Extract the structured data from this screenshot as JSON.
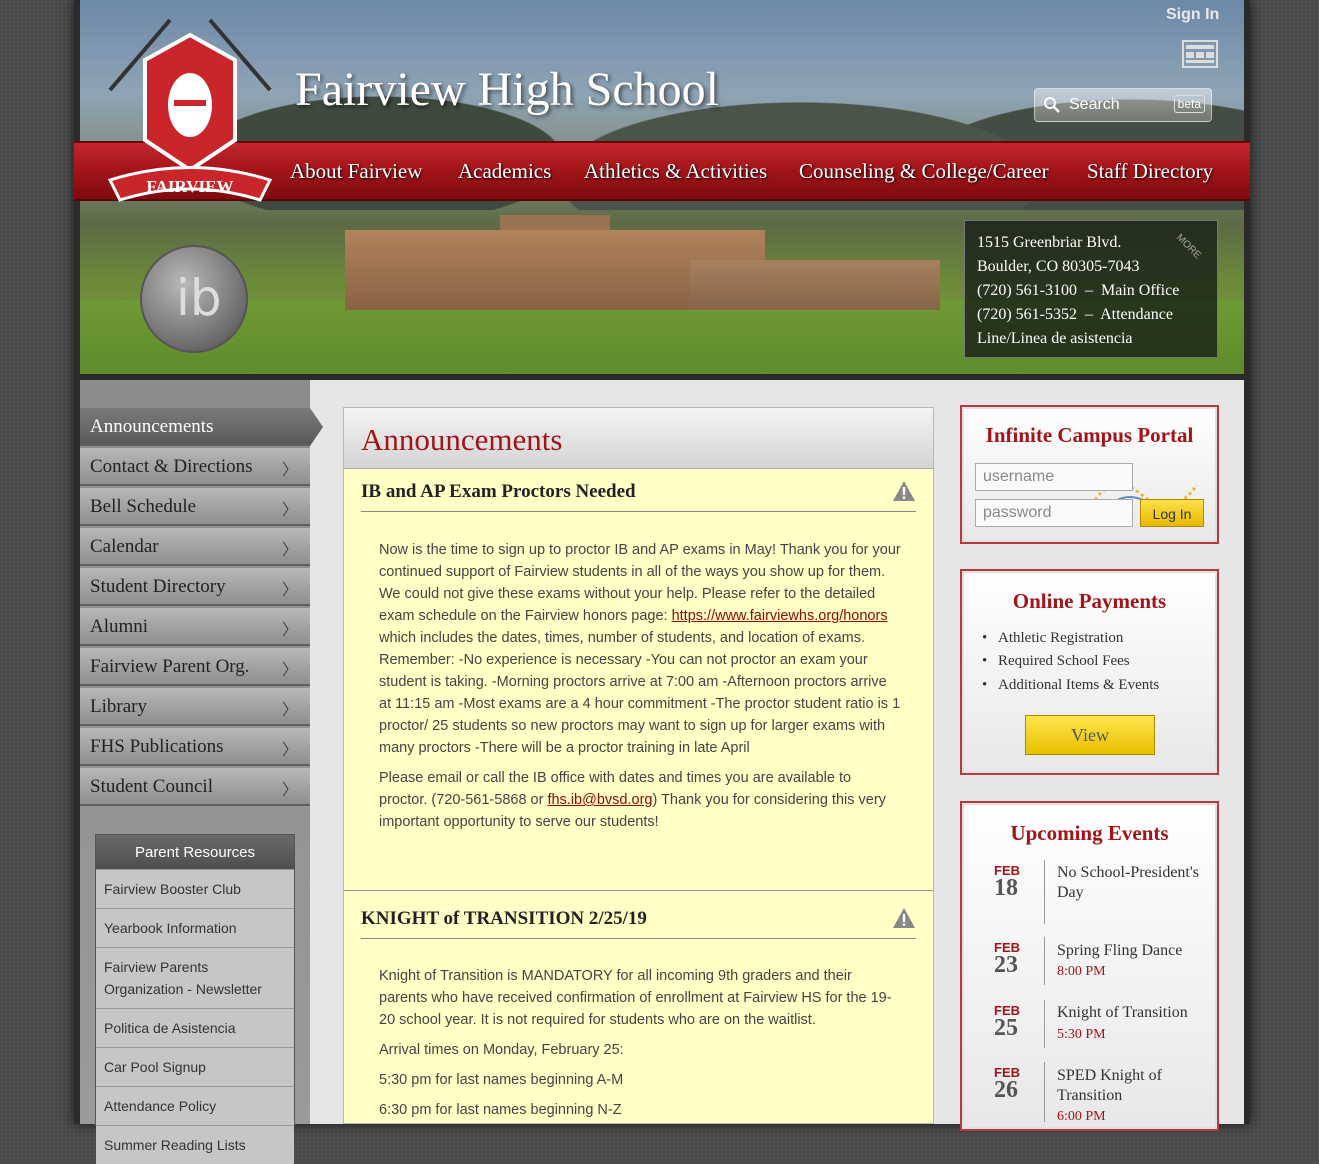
{
  "header": {
    "school_name": "Fairview High School",
    "sign_in": "Sign In",
    "search_placeholder": "Search",
    "search_badge": "beta",
    "logo_text": "FAIRVIEW",
    "nav": [
      "About Fairview",
      "Academics",
      "Athletics & Activities",
      "Counseling & College/Career",
      "Staff Directory"
    ],
    "address": {
      "line1": "1515 Greenbriar Blvd.",
      "line2": "Boulder, CO 80305-7043",
      "phone1": "(720) 561-3100  –  Main Office",
      "phone2": "(720) 561-5352  –  Attendance",
      "phone2b": "Line/Linea de asistencia",
      "more": "MORE"
    }
  },
  "sidebar": {
    "items": [
      {
        "label": "Announcements",
        "active": true
      },
      {
        "label": "Contact & Directions"
      },
      {
        "label": "Bell Schedule"
      },
      {
        "label": "Calendar"
      },
      {
        "label": "Student Directory"
      },
      {
        "label": "Alumni"
      },
      {
        "label": "Fairview Parent Org."
      },
      {
        "label": "Library"
      },
      {
        "label": "FHS Publications"
      },
      {
        "label": "Student Council"
      }
    ],
    "chevron": "〉",
    "parent_resources": {
      "title": "Parent Resources",
      "items": [
        "Fairview Booster Club",
        "Yearbook Information",
        "Fairview Parents Organization - Newsletter",
        "Politica de Asistencia",
        "Car Pool Signup",
        "Attendance Policy",
        "Summer Reading Lists"
      ]
    }
  },
  "main": {
    "title": "Announcements",
    "announcements": [
      {
        "title": "IB and AP Exam Proctors Needed",
        "p1_before": "Now is the time to sign up to proctor IB and AP exams in May! Thank you for your continued support of Fairview students in all of the ways you show up for them. We could not give these exams without your help. Please refer to the detailed exam schedule on the Fairview honors page: ",
        "p1_link": "https://www.fairviewhs.org/honors",
        "p1_after": " which includes the dates, times, number of students, and location of exams. Remember: -No experience is necessary -You can not proctor an exam your student is taking. -Morning proctors arrive at 7:00 am -Afternoon proctors arrive at 11:15 am -Most exams are a 4 hour commitment -The proctor student ratio is 1 proctor/ 25 students so new proctors may want to sign up for larger exams with many proctors -There will be a proctor training in late April",
        "p2_before": "Please email or call the IB office with dates and times you are available to proctor. (720-561-5868 or ",
        "p2_link": "fhs.ib@bvsd.org",
        "p2_after": ") Thank you for considering this very important opportunity to serve our students!"
      },
      {
        "title": "KNIGHT of TRANSITION 2/25/19",
        "p1": "Knight of Transition is MANDATORY for all incoming 9th graders and their parents who have received confirmation of enrollment at Fairview HS for the 19-20 school year. It is not required for students who are on the waitlist.",
        "p2": "Arrival times on Monday, February 25:",
        "p3": "5:30 pm for last names beginning A-M",
        "p4": "6:30 pm for last names beginning N-Z"
      }
    ]
  },
  "right": {
    "portal": {
      "title": "Infinite Campus Portal",
      "username_placeholder": "username",
      "password_placeholder": "password",
      "login": "Log In"
    },
    "payments": {
      "title": "Online Payments",
      "items": [
        "Athletic Registration",
        "Required School Fees",
        "Additional Items & Events"
      ],
      "button": "View"
    },
    "events": {
      "title": "Upcoming Events",
      "items": [
        {
          "month": "FEB",
          "day": "18",
          "name": "No School-President's Day",
          "time": ""
        },
        {
          "month": "FEB",
          "day": "23",
          "name": "Spring Fling Dance",
          "time": "8:00 PM"
        },
        {
          "month": "FEB",
          "day": "25",
          "name": "Knight of Transition",
          "time": "5:30 PM"
        },
        {
          "month": "FEB",
          "day": "26",
          "name": "SPED Knight of Transition",
          "time": "6:00 PM"
        }
      ]
    }
  },
  "colors": {
    "brand_red": "#a11419",
    "announcement_bg": "#ffffc6",
    "button_yellow": "#f2cf1a"
  }
}
